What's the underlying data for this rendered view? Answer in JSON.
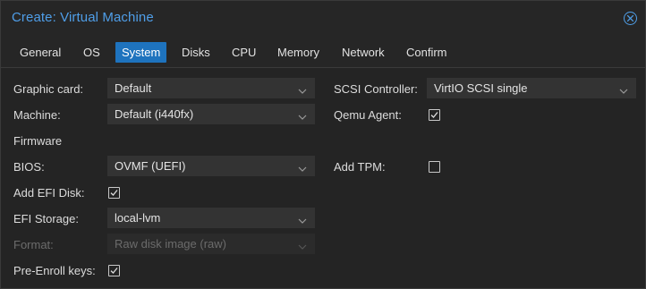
{
  "window": {
    "title": "Create: Virtual Machine"
  },
  "icons": {
    "close": "close-circle-icon",
    "dropdown": "chevron-down-icon",
    "checkmark": "checkmark-icon"
  },
  "colors": {
    "accent": "#4f9ee8",
    "active_tab": "#1e73be",
    "background": "#242424",
    "field": "#333333"
  },
  "tabs": [
    {
      "label": "General",
      "active": false
    },
    {
      "label": "OS",
      "active": false
    },
    {
      "label": "System",
      "active": true
    },
    {
      "label": "Disks",
      "active": false
    },
    {
      "label": "CPU",
      "active": false
    },
    {
      "label": "Memory",
      "active": false
    },
    {
      "label": "Network",
      "active": false
    },
    {
      "label": "Confirm",
      "active": false
    }
  ],
  "form": {
    "graphic_card": {
      "label": "Graphic card:",
      "value": "Default"
    },
    "machine": {
      "label": "Machine:",
      "value": "Default (i440fx)"
    },
    "firmware_heading": "Firmware",
    "bios": {
      "label": "BIOS:",
      "value": "OVMF (UEFI)"
    },
    "add_efi_disk": {
      "label": "Add EFI Disk:",
      "checked": true
    },
    "efi_storage": {
      "label": "EFI Storage:",
      "value": "local-lvm"
    },
    "format": {
      "label": "Format:",
      "value": "Raw disk image (raw)",
      "disabled": true
    },
    "pre_enroll_keys": {
      "label": "Pre-Enroll keys:",
      "checked": true
    },
    "scsi_controller": {
      "label": "SCSI Controller:",
      "value": "VirtIO SCSI single"
    },
    "qemu_agent": {
      "label": "Qemu Agent:",
      "checked": true
    },
    "add_tpm": {
      "label": "Add TPM:",
      "checked": false
    }
  }
}
